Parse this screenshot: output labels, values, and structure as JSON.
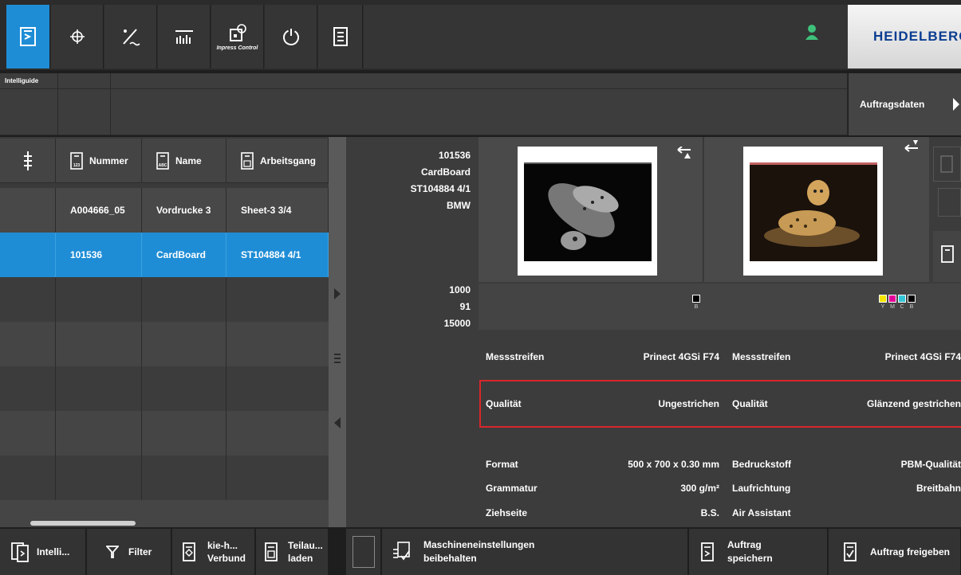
{
  "toolbar": {
    "tabs": [
      {
        "name": "job-tab-icon"
      },
      {
        "name": "register-icon"
      },
      {
        "name": "measure-icon"
      },
      {
        "name": "ink-zones-icon"
      },
      {
        "name": "inpress-control-icon",
        "label": "Inpress Control"
      },
      {
        "name": "power-timer-icon"
      },
      {
        "name": "job-list-icon"
      }
    ],
    "brand": "HEIDELBERG"
  },
  "intelliguide": {
    "label": "Intelliguide",
    "job_data_label": "Auftragsdaten"
  },
  "table": {
    "headers": [
      "Nummer",
      "Name",
      "Arbeitsgang"
    ],
    "rows": [
      [
        "A004666_05",
        "Vordrucke 3",
        "Sheet-3 3/4"
      ],
      [
        "101536",
        "CardBoard",
        "ST104884 4/1"
      ]
    ],
    "selected_row": 1
  },
  "details": {
    "summary": [
      "101536",
      "CardBoard",
      "ST104884 4/1",
      "BMW"
    ],
    "counts": [
      "1000",
      "91",
      "15000"
    ],
    "ink_front": [
      "B"
    ],
    "ink_back": [
      "Y",
      "M",
      "C",
      "B"
    ],
    "front": {
      "messstreifen_label": "Messstreifen",
      "messstreifen_value": "Prinect 4GSi F74",
      "qualitaet_label": "Qualität",
      "qualitaet_value": "Ungestrichen"
    },
    "back": {
      "messstreifen_label": "Messstreifen",
      "messstreifen_value": "Prinect 4GSi F74",
      "qualitaet_label": "Qualität",
      "qualitaet_value": "Glänzend gestrichen"
    },
    "props_left": [
      {
        "label": "Format",
        "value": "500 x 700 x 0.30 mm"
      },
      {
        "label": "Grammatur",
        "value": "300 g/m²"
      },
      {
        "label": "Ziehseite",
        "value": "B.S."
      }
    ],
    "props_right": [
      {
        "label": "Bedruckstoff",
        "value": "PBM-Qualität"
      },
      {
        "label": "Laufrichtung",
        "value": "Breitbahn"
      },
      {
        "label": "Air Assistant",
        "value": ""
      }
    ]
  },
  "bottom": {
    "intelli": "Intelli...",
    "filter": "Filter",
    "kie_line1": "kie-h...",
    "kie_line2": "Verbund",
    "teil_line1": "Teilau...",
    "teil_line2": "laden",
    "machine_line1": "Maschineneinstellungen",
    "machine_line2": "beibehalten",
    "save_line1": "Auftrag",
    "save_line2": "speichern",
    "release": "Auftrag freigeben"
  },
  "colors": {
    "accent": "#1f8dd6",
    "highlight": "#d9262a",
    "green": "#3ec07a"
  }
}
